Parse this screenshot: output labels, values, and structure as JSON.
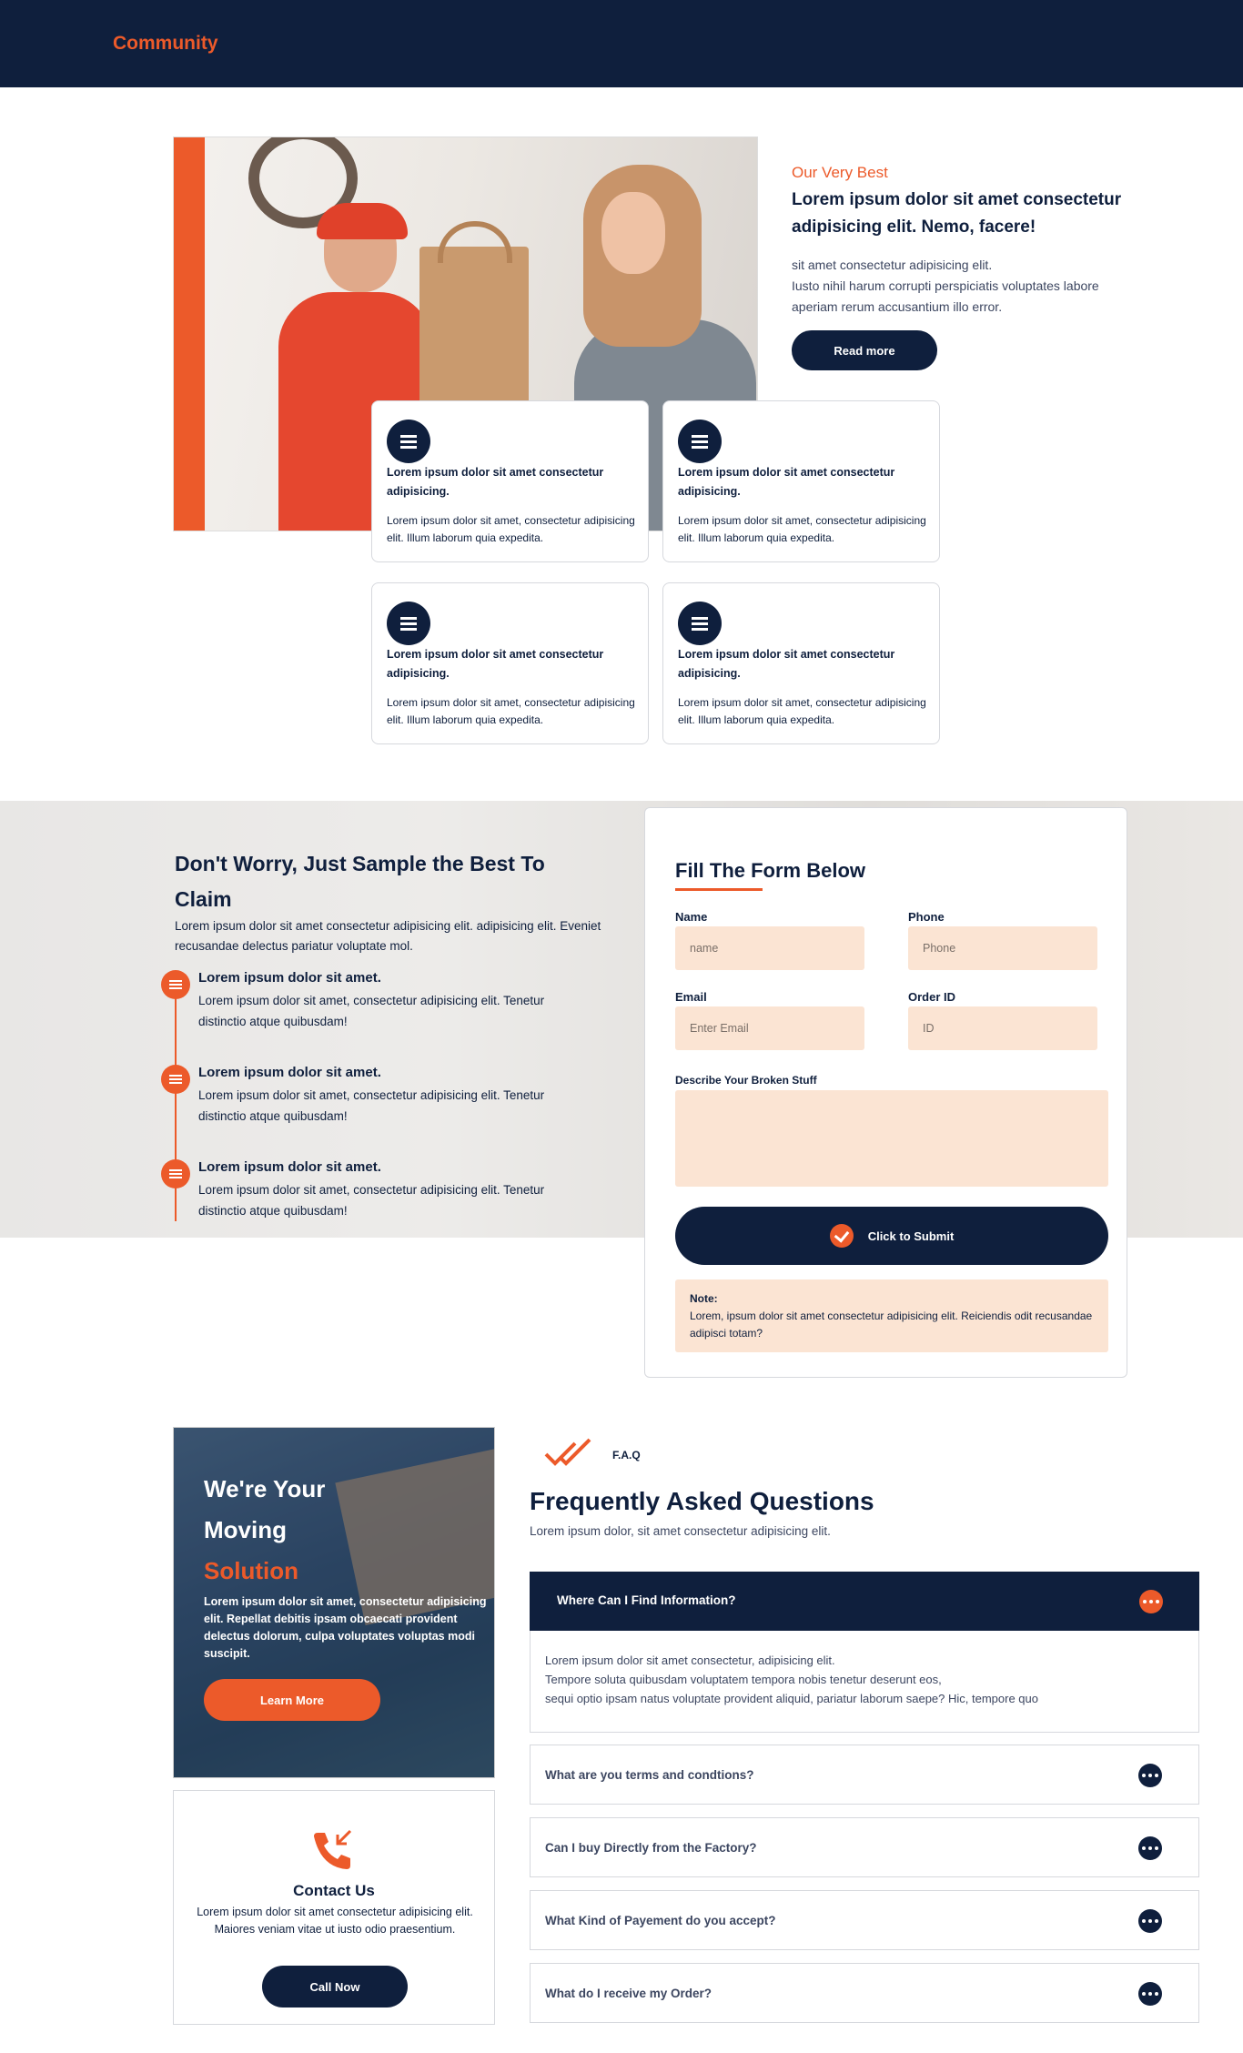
{
  "header": {
    "brand": "Community"
  },
  "about": {
    "eyebrow": "Our Very Best",
    "title": "Lorem ipsum dolor sit amet consectetur adipisicing elit. Nemo, facere!",
    "desc_line1": "sit amet consectetur adipisicing elit.",
    "desc_line2": "Iusto nihil harum corrupti perspiciatis voluptates labore aperiam rerum accusantium illo error.",
    "read_more": "Read more"
  },
  "features": [
    {
      "icon": "list-icon",
      "title": "Lorem ipsum dolor sit amet consectetur adipisicing.",
      "text": "Lorem ipsum dolor sit amet, consectetur adipisicing elit. Illum laborum quia expedita."
    },
    {
      "icon": "list-icon",
      "title": "Lorem ipsum dolor sit amet consectetur adipisicing.",
      "text": "Lorem ipsum dolor sit amet, consectetur adipisicing elit. Illum laborum quia expedita."
    },
    {
      "icon": "list-icon",
      "title": "Lorem ipsum dolor sit amet consectetur adipisicing.",
      "text": "Lorem ipsum dolor sit amet, consectetur adipisicing elit. Illum laborum quia expedita."
    },
    {
      "icon": "list-icon",
      "title": "Lorem ipsum dolor sit amet consectetur adipisicing.",
      "text": "Lorem ipsum dolor sit amet, consectetur adipisicing elit. Illum laborum quia expedita."
    }
  ],
  "claim": {
    "title": "Don't Worry, Just Sample the Best To Claim",
    "desc": "Lorem ipsum dolor sit amet consectetur adipisicing elit. adipisicing elit. Eveniet recusandae delectus pariatur voluptate mol.",
    "steps": [
      {
        "title": "Lorem ipsum dolor sit amet.",
        "text": "Lorem ipsum dolor sit amet, consectetur adipisicing elit. Tenetur distinctio atque quibusdam!"
      },
      {
        "title": "Lorem ipsum dolor sit amet.",
        "text": "Lorem ipsum dolor sit amet, consectetur adipisicing elit. Tenetur distinctio atque quibusdam!"
      },
      {
        "title": "Lorem ipsum dolor sit amet.",
        "text": "Lorem ipsum dolor sit amet, consectetur adipisicing elit. Tenetur distinctio atque quibusdam!"
      }
    ]
  },
  "form": {
    "title": "Fill The Form Below",
    "name_label": "Name",
    "name_placeholder": "name",
    "phone_label": "Phone",
    "phone_placeholder": "Phone",
    "email_label": "Email",
    "email_placeholder": "Enter Email",
    "order_label": "Order ID",
    "order_placeholder": "ID",
    "describe_label": "Describe Your Broken Stuff",
    "submit": "Click to Submit",
    "note_title": "Note:",
    "note_text": "Lorem, ipsum dolor sit amet consectetur adipisicing elit. Reiciendis odit recusandae adipisci totam?"
  },
  "promo": {
    "line1": "We're Your",
    "line2": "Moving",
    "line3": "Solution",
    "desc": "Lorem ipsum dolor sit amet, consectetur adipisicing elit. Repellat debitis ipsam obcaecati provident delectus dolorum, culpa voluptates voluptas modi suscipit.",
    "button": "Learn More"
  },
  "contact": {
    "title": "Contact Us",
    "desc": "Lorem ipsum dolor sit amet consectetur adipisicing elit. Maiores veniam vitae ut iusto odio praesentium.",
    "button": "Call Now"
  },
  "faq": {
    "tag": "F.A.Q",
    "title": "Frequently Asked Questions",
    "subtitle": "Lorem ipsum dolor, sit amet consectetur adipisicing elit.",
    "open_question": "Where Can I Find Information?",
    "open_answer_l1": "Lorem ipsum dolor sit amet consectetur, adipisicing elit.",
    "open_answer_l2": "Tempore soluta quibusdam voluptatem tempora nobis tenetur deserunt eos,",
    "open_answer_l3": "sequi optio ipsam natus voluptate provident aliquid, pariatur laborum saepe? Hic, tempore quo",
    "items": [
      "What are you terms and condtions?",
      "Can I buy Directly from the Factory?",
      "What Kind of Payement do you accept?",
      "What do I receive my Order?"
    ]
  },
  "colors": {
    "navy": "#0f1f3d",
    "accent": "#ec5a2a",
    "input_bg": "#fbe4d3"
  }
}
